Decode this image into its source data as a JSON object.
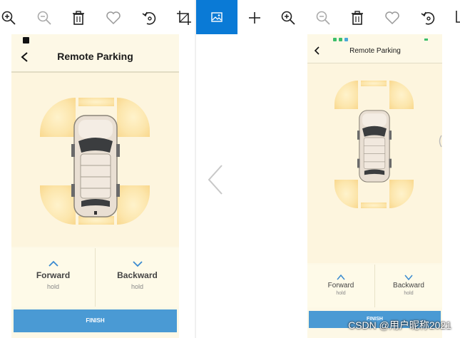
{
  "left_app": {
    "title": "Remote Parking",
    "forward_label": "Forward",
    "forward_sub": "hold",
    "backward_label": "Backward",
    "backward_sub": "hold",
    "finish_label": "FINISH"
  },
  "right_app": {
    "title": "Remote Parking",
    "forward_label": "Forward",
    "forward_sub": "hold",
    "backward_label": "Backward",
    "backward_sub": "hold",
    "finish_label": "FINISH"
  },
  "toolbar_left": [
    "zoom-in-icon",
    "zoom-out-icon",
    "delete-icon",
    "favorite-icon",
    "rotate-icon",
    "crop-icon"
  ],
  "toolbar_right": [
    "photo-icon",
    "add-icon",
    "zoom-in-icon",
    "zoom-out-icon",
    "delete-icon",
    "favorite-icon",
    "rotate-icon"
  ],
  "colors": {
    "accent": "#0a7ad6",
    "finish_button": "#4a9ad4",
    "phone_bg": "#fdf8e6",
    "zone": "#f3c66a"
  },
  "watermark": "CSDN @用户昵称2021"
}
